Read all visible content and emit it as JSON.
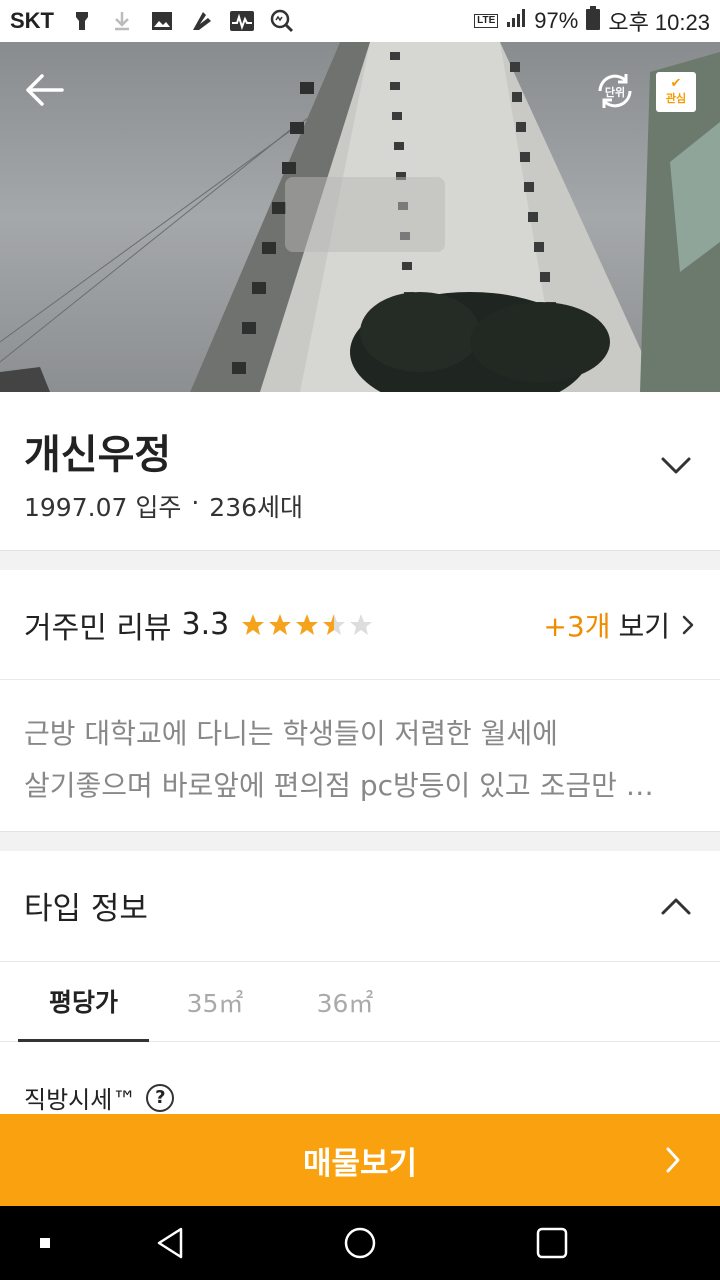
{
  "status_bar": {
    "carrier": "SKT",
    "battery": "97%",
    "time": "오후 10:23",
    "network": "LTE",
    "icons": [
      "flashlight-icon",
      "download-icon",
      "image-icon",
      "app-icon",
      "activity-icon",
      "search-icon"
    ]
  },
  "hero": {
    "back_icon": "arrow-left-icon",
    "unit_label": "단위",
    "favorite_label": "관심"
  },
  "apartment": {
    "name": "개신우정",
    "move_in": "1997.07 입주",
    "separator": "·",
    "households": "236세대"
  },
  "review": {
    "title": "거주민 리뷰",
    "score": "3.3",
    "rating": 3.3,
    "max_rating": 5,
    "count": "+3개",
    "see_label": "보기",
    "line1": "근방 대학교에 다니는 학생들이 저렴한 월세에",
    "line2": "살기좋으며 바로앞에 편의점 pc방등이 있고 조금만 …"
  },
  "type_info": {
    "title": "타입 정보",
    "tabs": [
      {
        "label": "평당가",
        "active": true
      },
      {
        "label": "35㎡",
        "active": false
      },
      {
        "label": "36㎡",
        "active": false
      }
    ],
    "market_label": "직방시세™",
    "help_icon_label": "?"
  },
  "cta": {
    "label": "매물보기"
  },
  "colors": {
    "accent": "#f9a10e",
    "orange_text": "#f08c00",
    "star": "#f5a31a",
    "star_empty": "#dddddd"
  }
}
